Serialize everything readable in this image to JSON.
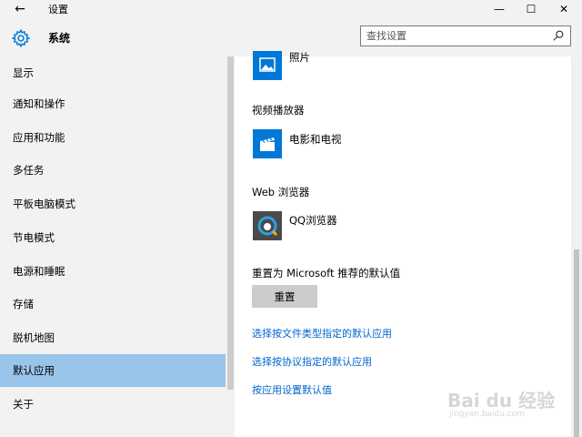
{
  "window": {
    "title": "设置",
    "back_label": "←",
    "min_label": "—",
    "max_label": "☐",
    "close_label": "✕"
  },
  "header": {
    "section_title": "系统",
    "search_placeholder": "查找设置"
  },
  "sidebar": {
    "items": [
      {
        "label": "显示"
      },
      {
        "label": "通知和操作"
      },
      {
        "label": "应用和功能"
      },
      {
        "label": "多任务"
      },
      {
        "label": "平板电脑模式"
      },
      {
        "label": "节电模式"
      },
      {
        "label": "电源和睡眠"
      },
      {
        "label": "存储"
      },
      {
        "label": "脱机地图"
      },
      {
        "label": "默认应用",
        "selected": true
      },
      {
        "label": "关于"
      }
    ]
  },
  "main": {
    "photo_app": "照片",
    "video_heading": "视频播放器",
    "video_app": "电影和电视",
    "browser_heading": "Web 浏览器",
    "browser_app": "QQ浏览器",
    "reset_label": "重置为 Microsoft 推荐的默认值",
    "reset_button": "重置",
    "links": [
      "选择按文件类型指定的默认应用",
      "选择按协议指定的默认应用",
      "按应用设置默认值"
    ]
  },
  "watermark": {
    "text": "Bai du 经验",
    "url": "jingyan.baidu.com"
  },
  "colors": {
    "accent": "#0078d7",
    "selected_bg": "#99c5eb",
    "link": "#0066cc",
    "chrome_bg": "#f2f2f2"
  }
}
